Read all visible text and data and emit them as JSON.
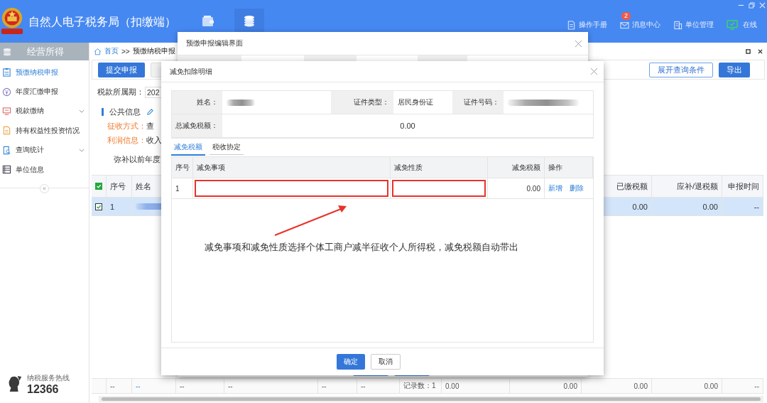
{
  "header": {
    "title": "自然人电子税务局（扣缴端）",
    "nav_tabs": [
      {
        "kind": "wallet",
        "selected": false
      },
      {
        "kind": "coins",
        "selected": true
      }
    ],
    "links": [
      {
        "kind": "manual",
        "label": "操作手册"
      },
      {
        "kind": "mail",
        "label": "消息中心",
        "badge": "2"
      },
      {
        "kind": "building",
        "label": "单位管理"
      },
      {
        "kind": "online",
        "label": "在线"
      }
    ]
  },
  "sidebar": {
    "title": "经营所得",
    "items": [
      {
        "kind": "clipboard",
        "label": "预缴纳税申报",
        "selected": true,
        "expandable": false
      },
      {
        "kind": "yen",
        "label": "年度汇缴申报",
        "selected": false,
        "expandable": false
      },
      {
        "kind": "monitor",
        "label": "税款缴纳",
        "selected": false,
        "expandable": true
      },
      {
        "kind": "document",
        "label": "持有权益性投资情况",
        "selected": false,
        "expandable": false
      },
      {
        "kind": "search",
        "label": "查询统计",
        "selected": false,
        "expandable": true
      },
      {
        "kind": "list",
        "label": "单位信息",
        "selected": false,
        "expandable": false
      }
    ],
    "collapse": "«",
    "hotline": {
      "caption": "纳税服务热线",
      "number": "12366"
    }
  },
  "main": {
    "breadcrumb": {
      "home": "首页",
      "separator": ">>",
      "current": "预缴纳税申报"
    },
    "toolbar": {
      "left": [
        {
          "kind": "primary",
          "label": "提交申报"
        },
        {
          "kind": "covered"
        }
      ],
      "right": [
        {
          "kind": "outline",
          "label": "展开查询条件"
        },
        {
          "kind": "primary",
          "label": "导出"
        }
      ]
    },
    "period": {
      "label": "税款所属期：",
      "value": "202"
    },
    "public_info": {
      "title": "公共信息",
      "fields": [
        {
          "label": "征收方式：",
          "value": "查"
        },
        {
          "label": "利润信息：",
          "value": "收入"
        }
      ],
      "note": "弥补以前年度"
    },
    "table": {
      "header_checked": true,
      "columns": [
        "序号",
        "姓名",
        null,
        null,
        null,
        null,
        null,
        null,
        null,
        "已缴税额",
        "应补/退税额",
        "申报时间"
      ],
      "rows": [
        {
          "selected": true,
          "checked": true,
          "cells": [
            "1",
            {
              "kind": "blurred"
            },
            null,
            null,
            null,
            null,
            null,
            null,
            null,
            "0.00",
            "0.00",
            "--"
          ]
        }
      ],
      "summary": [
        "--",
        {
          "kind": "link",
          "text": "--"
        },
        "--",
        "--",
        "--",
        "--",
        "记录数：1",
        "0.00",
        "0.00",
        "0.00",
        "0.00",
        "--"
      ]
    }
  },
  "edit_dialog": {
    "title": "预缴申报编辑界面",
    "footer_buttons": [
      {
        "kind": "primary"
      },
      {
        "kind": "primary"
      }
    ]
  },
  "relief_dialog": {
    "title": "减免扣除明细",
    "info": {
      "name_label": "姓名：",
      "name": {
        "kind": "blurred"
      },
      "id_type_label": "证件类型：",
      "id_type": "居民身份证",
      "id_number_label": "证件号码：",
      "id_number": {
        "kind": "blurred"
      },
      "total_label": "总减免税额：",
      "total": "0.00"
    },
    "tabs": [
      {
        "label": "减免税额",
        "selected": true
      },
      {
        "label": "税收协定",
        "selected": false
      }
    ],
    "table": {
      "columns": [
        "序号",
        "减免事项",
        "减免性质",
        "减免税额",
        "操作"
      ],
      "rows": [
        {
          "index": "1",
          "item_highlighted": true,
          "nature_highlighted": true,
          "amount": "0.00",
          "actions": [
            "新增",
            "删除"
          ]
        }
      ]
    },
    "annotation": "减免事项和减免性质选择个体工商户减半征收个人所得税，减免税额自动带出",
    "buttons": [
      {
        "kind": "primary",
        "label": "确定"
      },
      {
        "kind": "default",
        "label": "取消"
      }
    ]
  }
}
